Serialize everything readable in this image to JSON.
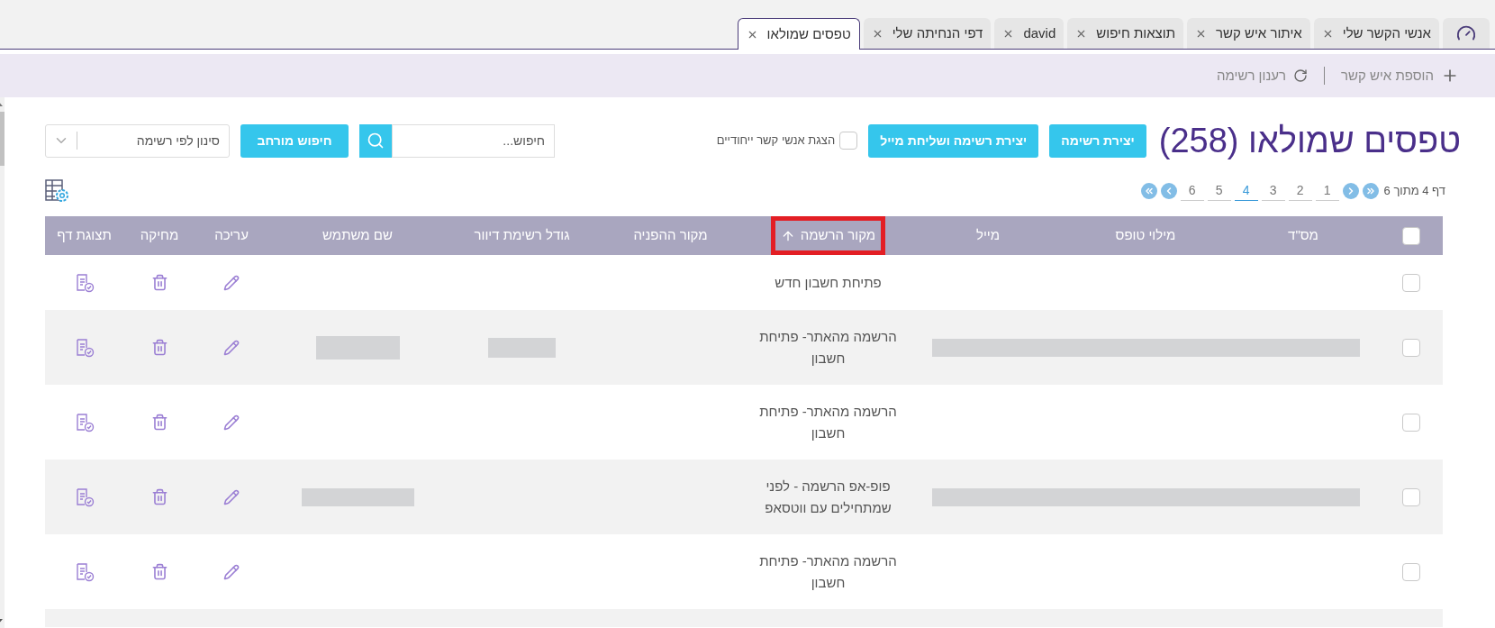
{
  "tabs": [
    {
      "label": "אנשי הקשר שלי",
      "selected": false
    },
    {
      "label": "איתור איש קשר",
      "selected": false
    },
    {
      "label": "תוצאות חיפוש",
      "selected": false
    },
    {
      "label": "david",
      "selected": false
    },
    {
      "label": "דפי הנחיתה שלי",
      "selected": false
    },
    {
      "label": "טפסים שמולאו",
      "selected": true
    }
  ],
  "toolbar": [
    {
      "kind": "add",
      "label": "הוספת איש קשר"
    },
    {
      "kind": "refresh",
      "label": "רענון רשימה"
    }
  ],
  "title": "טפסים שמולאו (258)",
  "buttons": [
    {
      "label": "יצירת רשימה"
    },
    {
      "label": "יצירת רשימה ושליחת מייל"
    }
  ],
  "unique_contacts": {
    "label": "הצגת אנשי קשר ייחודיים",
    "checked": false
  },
  "search": {
    "placeholder": "חיפוש..."
  },
  "advanced_search": "חיפוש מורחב",
  "list_filter": {
    "placeholder": "סינון לפי רשימה"
  },
  "pagination": {
    "summary": "דף 4 מתוך 6",
    "pages": [
      {
        "label": "1",
        "selected": false
      },
      {
        "label": "2",
        "selected": false
      },
      {
        "label": "3",
        "selected": false
      },
      {
        "label": "4",
        "selected": true
      },
      {
        "label": "5",
        "selected": false
      },
      {
        "label": "6",
        "selected": false
      }
    ]
  },
  "table": {
    "select_all_checked": false,
    "columns": [
      {
        "label": "מס\"ד",
        "sorted": false,
        "highlighted": false
      },
      {
        "label": "מילוי טופס",
        "sorted": false,
        "highlighted": false
      },
      {
        "label": "מייל",
        "sorted": false,
        "highlighted": false
      },
      {
        "label": "מקור הרשמה",
        "sorted": true,
        "highlighted": true
      },
      {
        "label": "מקור ההפניה",
        "sorted": false,
        "highlighted": false
      },
      {
        "label": "גודל רשימת דיוור",
        "sorted": false,
        "highlighted": false
      },
      {
        "label": "שם משתמש",
        "sorted": false,
        "highlighted": false
      },
      {
        "label": "עריכה",
        "sorted": false,
        "highlighted": false
      },
      {
        "label": "מחיקה",
        "sorted": false,
        "highlighted": false
      },
      {
        "label": "תצוגת דף",
        "sorted": false,
        "highlighted": false
      }
    ],
    "rows": [
      {
        "checked": false,
        "source": "פתיחת חשבון חדש",
        "email_redacted": false,
        "list_size_redacted": false,
        "username_redacted": false
      },
      {
        "checked": false,
        "source": "הרשמה מהאתר- פתיחת חשבון",
        "email_redacted": true,
        "list_size_redacted": true,
        "username_redacted": true
      },
      {
        "checked": false,
        "source": "הרשמה מהאתר- פתיחת חשבון",
        "email_redacted": false,
        "list_size_redacted": false,
        "username_redacted": false
      },
      {
        "checked": false,
        "source": "פופ-אפ הרשמה - לפני שמתחילים עם ווטסאפ",
        "email_redacted": true,
        "list_size_redacted": false,
        "username_redacted": true
      },
      {
        "checked": false,
        "source": "הרשמה מהאתר- פתיחת חשבון",
        "email_redacted": false,
        "list_size_redacted": false,
        "username_redacted": false
      }
    ]
  }
}
